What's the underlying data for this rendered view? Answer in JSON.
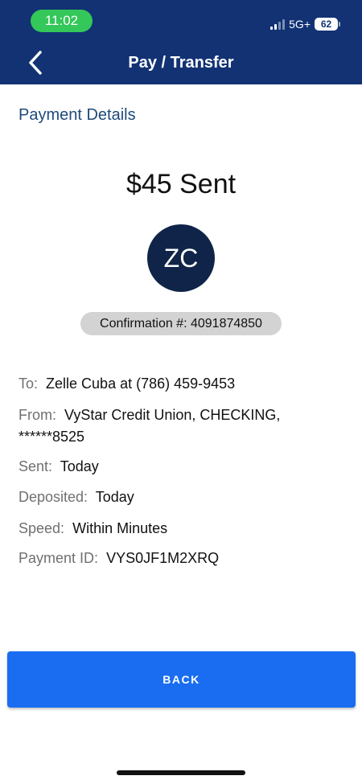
{
  "status_bar": {
    "time": "11:02",
    "network": "5G+",
    "battery": "62"
  },
  "header": {
    "title": "Pay / Transfer"
  },
  "section_title": "Payment Details",
  "amount_text": "$45 Sent",
  "avatar_initials": "ZC",
  "confirmation": "Confirmation #: 4091874850",
  "details": {
    "to": {
      "label": "To:",
      "value": "Zelle Cuba at (786) 459-9453"
    },
    "from": {
      "label": "From:",
      "value": "VyStar Credit Union, CHECKING,",
      "value_line2": "******8525"
    },
    "sent": {
      "label": "Sent:",
      "value": "Today"
    },
    "deposited": {
      "label": "Deposited:",
      "value": "Today"
    },
    "speed": {
      "label": "Speed:",
      "value": "Within Minutes"
    },
    "payment_id": {
      "label": "Payment ID:",
      "value": "VYS0JF1M2XRQ"
    }
  },
  "back_button_label": "BACK",
  "colors": {
    "header_bg": "#123274",
    "button_bg": "#1a6df0",
    "avatar_bg": "#0f2448",
    "time_pill": "#34c759"
  }
}
